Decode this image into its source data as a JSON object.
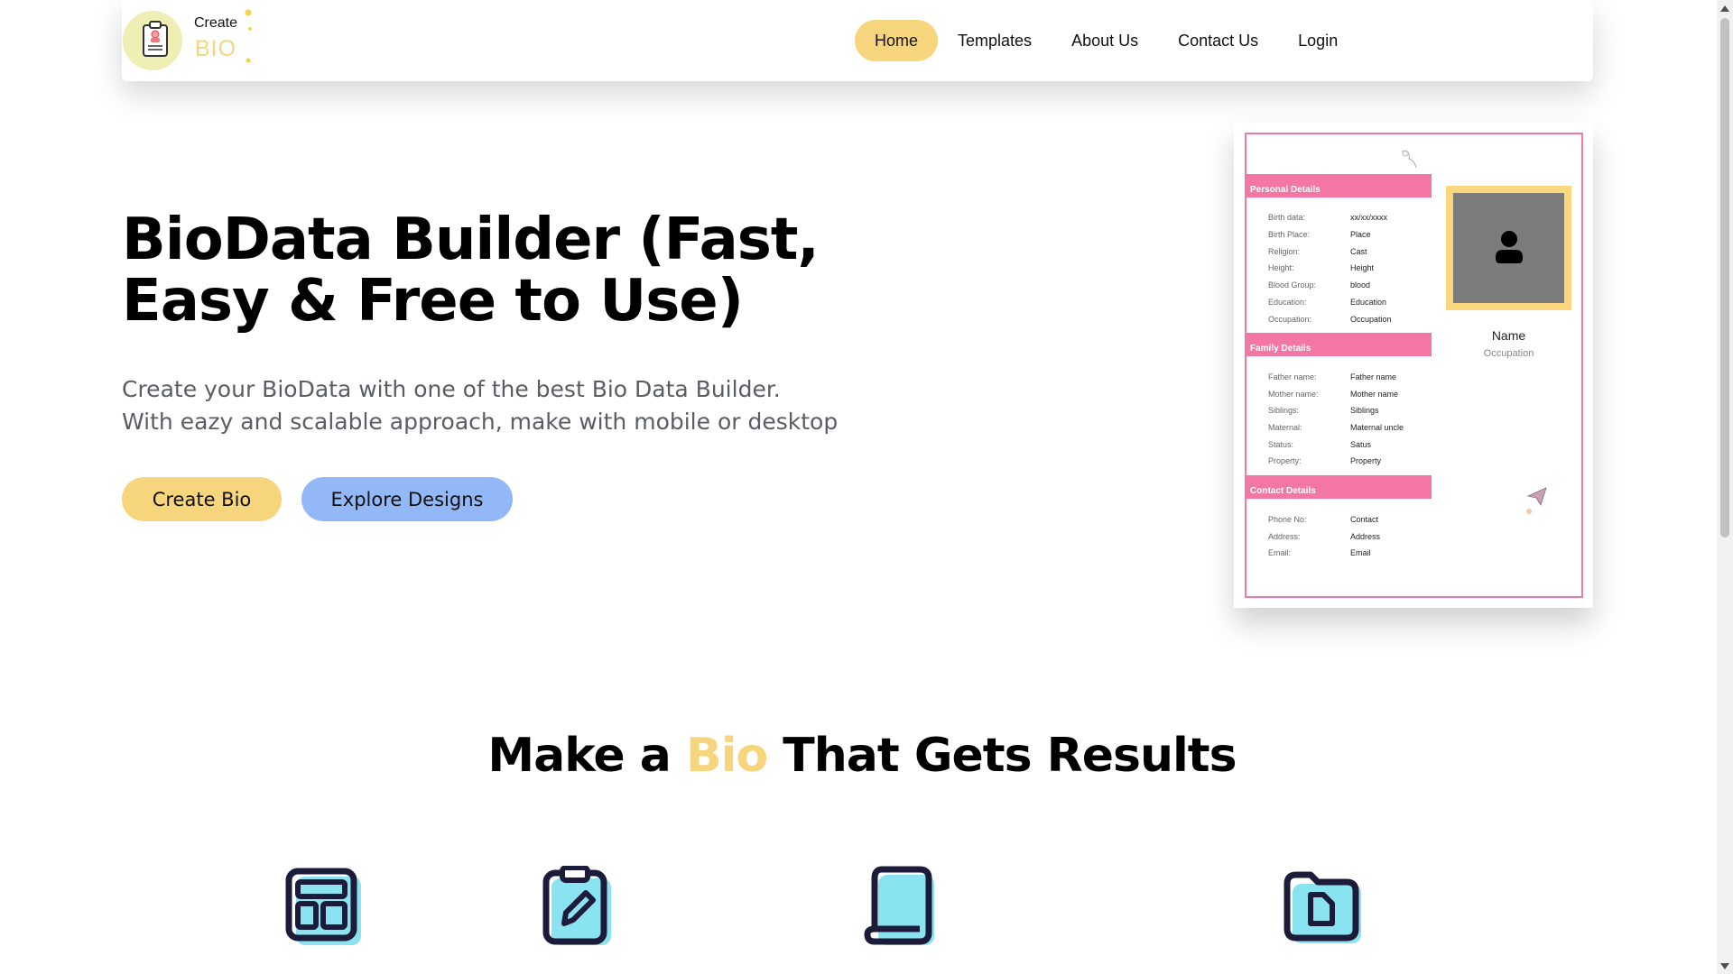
{
  "brand": {
    "create": "Create",
    "bio": "BIO"
  },
  "nav": {
    "items": [
      {
        "label": "Home",
        "active": true
      },
      {
        "label": "Templates",
        "active": false
      },
      {
        "label": "About Us",
        "active": false
      },
      {
        "label": "Contact Us",
        "active": false
      },
      {
        "label": "Login",
        "active": false
      }
    ]
  },
  "hero": {
    "title_line1": "BioData Builder (Fast,",
    "title_line2": "Easy & Free to Use)",
    "sub_line1": "Create your BioData with one of the best Bio Data Builder.",
    "sub_line2": "With eazy and scalable approach, make with mobile or desktop",
    "create_button": "Create Bio",
    "explore_button": "Explore Designs"
  },
  "preview": {
    "personal_title": "Personal Details",
    "personal": [
      {
        "k": "Birth data:",
        "v": "xx/xx/xxxx"
      },
      {
        "k": "Birth Place:",
        "v": "Place"
      },
      {
        "k": "Religion:",
        "v": "Cast"
      },
      {
        "k": "Height:",
        "v": "Height"
      },
      {
        "k": "Blood Group:",
        "v": "blood"
      },
      {
        "k": "Education:",
        "v": "Education"
      },
      {
        "k": "Occupation:",
        "v": "Occupation"
      }
    ],
    "family_title": "Family Details",
    "family": [
      {
        "k": "Father name:",
        "v": "Father name"
      },
      {
        "k": "Mother name:",
        "v": "Mother name"
      },
      {
        "k": "Siblings:",
        "v": "Siblings"
      },
      {
        "k": "Maternal:",
        "v": "Maternal uncle"
      },
      {
        "k": "Status:",
        "v": "Satus"
      },
      {
        "k": "Property:",
        "v": "Property"
      }
    ],
    "contact_title": "Contact Details",
    "contact": [
      {
        "k": "Phone No:",
        "v": "Contact"
      },
      {
        "k": "Address:",
        "v": "Address"
      },
      {
        "k": "Email:",
        "v": "Email"
      }
    ],
    "name": "Name",
    "occupation": "Occupation"
  },
  "results": {
    "pre": "Make a ",
    "highlight": "Bio",
    "post": " That Gets Results"
  },
  "features": [
    {
      "icon": "layout-icon"
    },
    {
      "icon": "clipboard-edit-icon"
    },
    {
      "icon": "scroll-document-icon"
    },
    {
      "icon": "folder-file-icon"
    }
  ],
  "colors": {
    "accent": "#f7d57c",
    "secondary": "#93b8f8",
    "pink": "#f476a5",
    "icon_fill": "#8ae3f0",
    "icon_stroke": "#1c1c3a"
  }
}
